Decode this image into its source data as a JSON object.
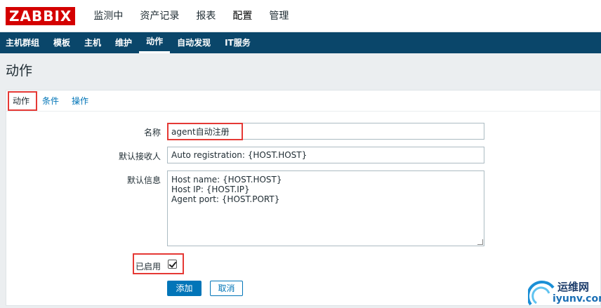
{
  "header": {
    "logo": "ZABBIX",
    "menu": [
      "监测中",
      "资产记录",
      "报表",
      "配置",
      "管理"
    ],
    "active_menu": "配置"
  },
  "subnav": {
    "items": [
      "主机群组",
      "模板",
      "主机",
      "维护",
      "动作",
      "自动发现",
      "IT服务"
    ],
    "active": "动作"
  },
  "page": {
    "title": "动作"
  },
  "tabs": {
    "items": [
      "动作",
      "条件",
      "操作"
    ],
    "active": "动作"
  },
  "form": {
    "name": {
      "label": "名称",
      "value": "agent自动注册"
    },
    "default_recipient": {
      "label": "默认接收人",
      "value": "Auto registration: {HOST.HOST}"
    },
    "default_message": {
      "label": "默认信息",
      "value": "Host name: {HOST.HOST}\nHost IP: {HOST.IP}\nAgent port: {HOST.PORT}"
    },
    "enabled": {
      "label": "已启用",
      "checked": true
    },
    "add_button": "添加",
    "cancel_button": "取消"
  },
  "watermark": {
    "line1": "运维网",
    "line2": "iyunv.com"
  },
  "colors": {
    "brand_red": "#d40000",
    "nav_bg": "#0a466a",
    "accent": "#0275b8",
    "highlight": "#e53935"
  }
}
